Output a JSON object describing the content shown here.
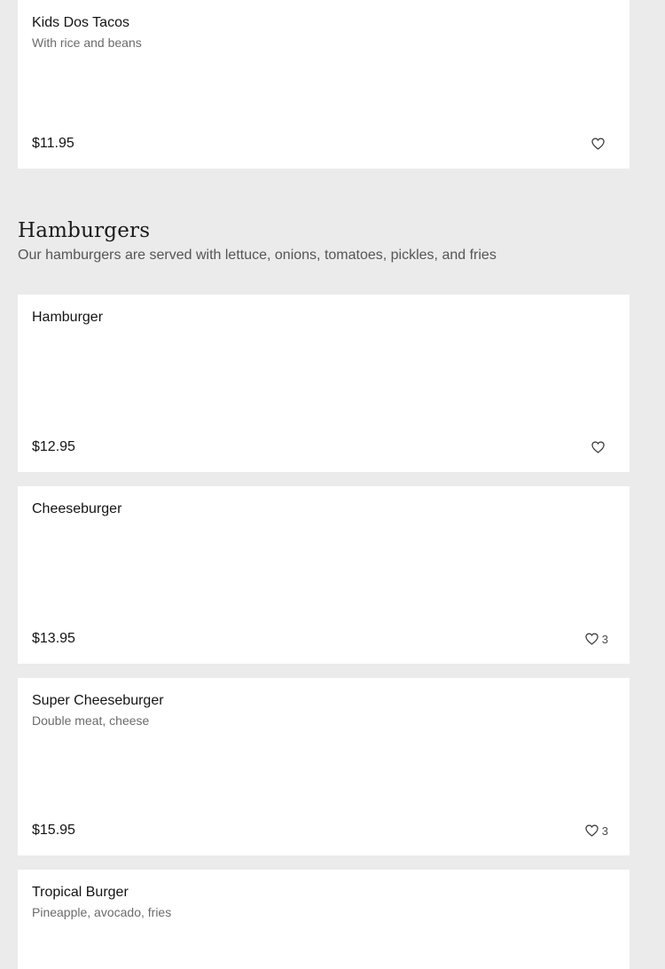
{
  "items_top": [
    {
      "name": "Kids Dos Tacos",
      "description": "With rice and beans",
      "price": "$11.95",
      "favorites": ""
    }
  ],
  "section": {
    "title": "Hamburgers",
    "description": "Our hamburgers are served with lettuce, onions, tomatoes, pickles, and fries"
  },
  "items": [
    {
      "name": "Hamburger",
      "description": "",
      "price": "$12.95",
      "favorites": ""
    },
    {
      "name": "Cheeseburger",
      "description": "",
      "price": "$13.95",
      "favorites": "3"
    },
    {
      "name": "Super Cheeseburger",
      "description": "Double meat, cheese",
      "price": "$15.95",
      "favorites": "3"
    },
    {
      "name": "Tropical Burger",
      "description": "Pineapple, avocado, fries",
      "price": "",
      "favorites": ""
    }
  ],
  "icons": {
    "favorite": "heart-outline-icon"
  },
  "colors": {
    "background": "#ebebeb",
    "card": "#ffffff",
    "text": "#141414",
    "muted_text": "#6b6b6b"
  }
}
